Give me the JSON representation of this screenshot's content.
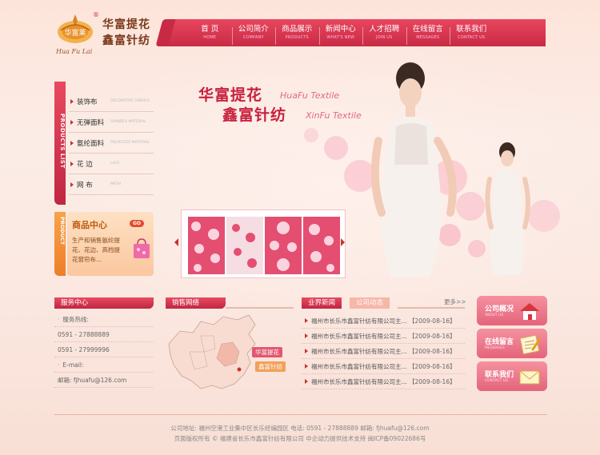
{
  "logo": {
    "line1": "华富提花",
    "line2": "鑫富针纺",
    "sub": "Hua Fu Lai",
    "mark": "华富莱"
  },
  "nav": [
    {
      "cn": "首 页",
      "en": "HOME"
    },
    {
      "cn": "公司简介",
      "en": "COMPANY"
    },
    {
      "cn": "商品展示",
      "en": "PRODUCTS"
    },
    {
      "cn": "新闻中心",
      "en": "WHAT'S NEW"
    },
    {
      "cn": "人才招聘",
      "en": "JOIN US"
    },
    {
      "cn": "在线留言",
      "en": "MESSAGES"
    },
    {
      "cn": "联系我们",
      "en": "CONTACT US"
    }
  ],
  "products_list": {
    "tab": "PRODUCTS LIST",
    "items": [
      {
        "cn": "装饰布",
        "en": "DECORATIVE FABRICS"
      },
      {
        "cn": "无弹面料",
        "en": "SPANDEX MATERIAL"
      },
      {
        "cn": "氨纶面料",
        "en": "POLYESTER MATERIAL"
      },
      {
        "cn": "花 边",
        "en": "LACE"
      },
      {
        "cn": "网 布",
        "en": "MESH"
      }
    ]
  },
  "product_center": {
    "tab": "PRODUCT",
    "title": "商品中心",
    "go": "GO",
    "desc": "生产和销售氨纶提花、花边、高档提花窗帘布..."
  },
  "hero": {
    "title1": "华富提花",
    "en1": "HuaFu Textile",
    "title2": "鑫富针纺",
    "en2": "XinFu Textile"
  },
  "service": {
    "title": "服务中心",
    "rows": [
      "服务热线:",
      "0591 - 27888889",
      "0591 - 27999996",
      "E-mail:",
      "邮箱: fjhuafu@126.com"
    ]
  },
  "sales": {
    "title": "销售网络",
    "label1": "华富提花",
    "label2": "鑫富针纺"
  },
  "news": {
    "tab_active": "业界新闻",
    "tab_inactive": "公司动态",
    "more": "更多>>",
    "items": [
      {
        "title": "福州市长乐市鑫富针纺有限公司主...",
        "date": "【2009-08-16】"
      },
      {
        "title": "福州市长乐市鑫富针纺有限公司主...",
        "date": "【2009-08-16】"
      },
      {
        "title": "福州市长乐市鑫富针纺有限公司主...",
        "date": "【2009-08-16】"
      },
      {
        "title": "福州市长乐市鑫富针纺有限公司主...",
        "date": "【2009-08-16】"
      },
      {
        "title": "福州市长乐市鑫富针纺有限公司主...",
        "date": "【2009-08-16】"
      }
    ]
  },
  "right_buttons": [
    {
      "cn": "公司概况",
      "en": "ABOUT US",
      "icon": "house-icon"
    },
    {
      "cn": "在线留言",
      "en": "MESSAGES",
      "icon": "notepad-icon"
    },
    {
      "cn": "联系我们",
      "en": "CONTACT US",
      "icon": "envelope-icon"
    }
  ],
  "footer": {
    "line1": "公司地址: 福州空港工业集中区长乐经编园区 电话: 0591 - 27888889 邮箱: fjhuafu@126.com",
    "line2": "页面版权所有 © 福建省长乐市鑫富针纺有限公司 中企动力提供技术支持 闽ICP备09022686号"
  },
  "colors": {
    "accent": "#c82a45",
    "orange": "#ee7f29",
    "background": "#fbe8df"
  }
}
